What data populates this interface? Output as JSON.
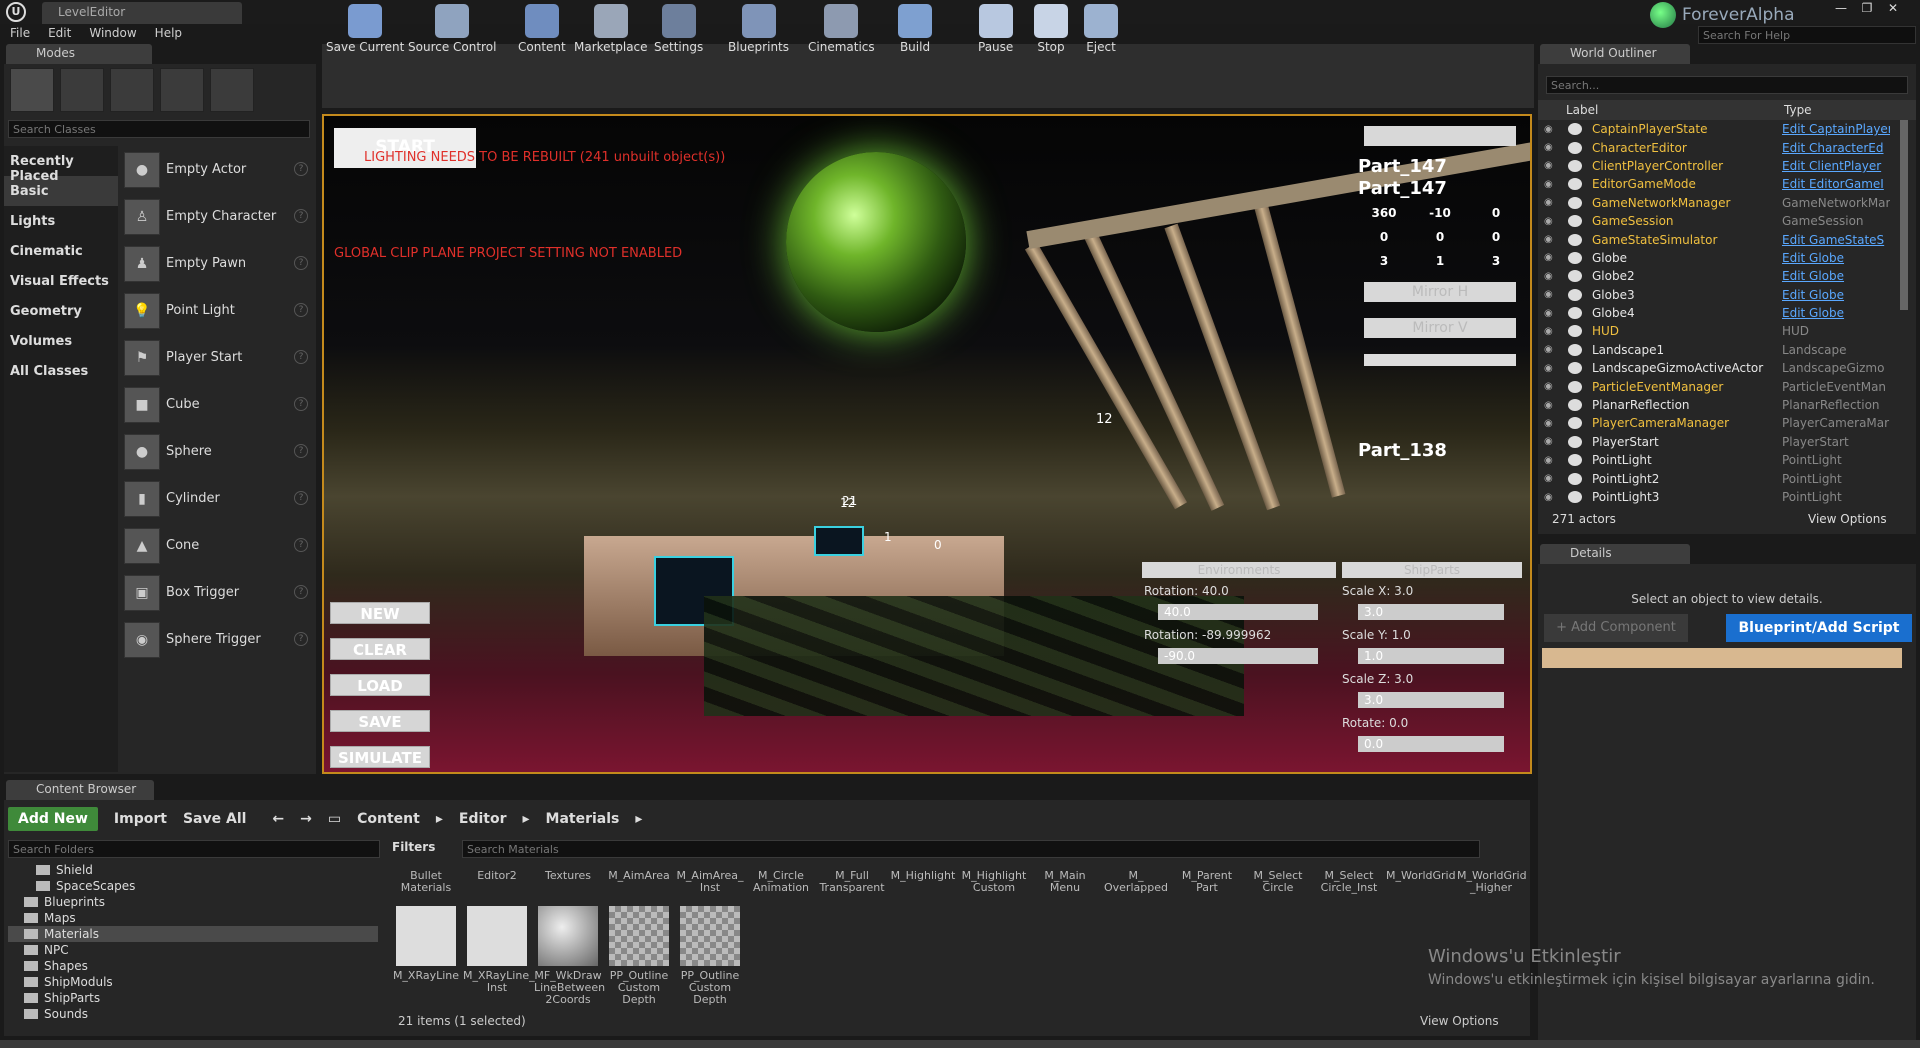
{
  "window": {
    "doc_tab": "LevelEditor",
    "brand": "ForeverAlpha",
    "search_help": "Search For Help",
    "min": "—",
    "max": "❐",
    "close": "✕"
  },
  "menu": [
    "File",
    "Edit",
    "Window",
    "Help"
  ],
  "modes": {
    "tab": "Modes",
    "search_placeholder": "Search Classes",
    "categories": [
      "Recently Placed",
      "Basic",
      "Lights",
      "Cinematic",
      "Visual Effects",
      "Geometry",
      "Volumes",
      "All Classes"
    ],
    "selected_category": "Basic",
    "actors": [
      "Empty Actor",
      "Empty Character",
      "Empty Pawn",
      "Point Light",
      "Player Start",
      "Cube",
      "Sphere",
      "Cylinder",
      "Cone",
      "Box Trigger",
      "Sphere Trigger"
    ]
  },
  "toolbar": [
    "Save Current",
    "Source Control",
    "Content",
    "Marketplace",
    "Settings",
    "Blueprints",
    "Cinematics",
    "Build",
    "Pause",
    "Stop",
    "Eject"
  ],
  "viewport": {
    "start": "START",
    "lighting_warning": "LIGHTING NEEDS TO BE REBUILT (241 unbuilt object(s))",
    "clip_warning": "GLOBAL CLIP PLANE PROJECT SETTING NOT ENABLED",
    "buttons": [
      "NEW",
      "CLEAR",
      "LOAD",
      "SAVE",
      "SIMULATE"
    ],
    "part_a": "Part_147",
    "part_b": "Part_147",
    "part_c": "Part_138",
    "rows": [
      [
        "360",
        "-10",
        "0"
      ],
      [
        "0",
        "0",
        "0"
      ],
      [
        "3",
        "1",
        "3"
      ]
    ],
    "mirror_h": "Mirror H",
    "mirror_v": "Mirror V",
    "environments": "Environments",
    "shipparts": "ShipParts",
    "rot1_label": "Rotation: 40.0",
    "rot1_val": "40.0",
    "rot2_label": "Rotation: -89.999962",
    "rot2_val": "-90.0",
    "sx_label": "Scale X: 3.0",
    "sx_val": "3.0",
    "sy_label": "Scale Y: 1.0",
    "sy_val": "1.0",
    "sz_label": "Scale Z: 3.0",
    "sz_val": "3.0",
    "rotate_label": "Rotate: 0.0",
    "rotate_val": "0.0",
    "nums": [
      "12",
      "21",
      "1",
      "0"
    ]
  },
  "outliner": {
    "tab": "World Outliner",
    "search_placeholder": "Search...",
    "col_label": "Label",
    "col_type": "Type",
    "rows": [
      {
        "name": "CaptainPlayerState",
        "type": "Edit CaptainPlayer",
        "link": true,
        "hl": true
      },
      {
        "name": "CharacterEditor",
        "type": "Edit CharacterEd",
        "link": true,
        "hl": true
      },
      {
        "name": "ClientPlayerController",
        "type": "Edit ClientPlayer",
        "link": true,
        "hl": true
      },
      {
        "name": "EditorGameMode",
        "type": "Edit EditorGameI",
        "link": true,
        "hl": true
      },
      {
        "name": "GameNetworkManager",
        "type": "GameNetworkMar",
        "link": false,
        "hl": true
      },
      {
        "name": "GameSession",
        "type": "GameSession",
        "link": false,
        "hl": true
      },
      {
        "name": "GameStateSimulator",
        "type": "Edit GameStateS",
        "link": true,
        "hl": true
      },
      {
        "name": "Globe",
        "type": "Edit Globe",
        "link": true,
        "hl": false
      },
      {
        "name": "Globe2",
        "type": "Edit Globe",
        "link": true,
        "hl": false
      },
      {
        "name": "Globe3",
        "type": "Edit Globe",
        "link": true,
        "hl": false
      },
      {
        "name": "Globe4",
        "type": "Edit Globe",
        "link": true,
        "hl": false
      },
      {
        "name": "HUD",
        "type": "HUD",
        "link": false,
        "hl": true
      },
      {
        "name": "Landscape1",
        "type": "Landscape",
        "link": false,
        "hl": false
      },
      {
        "name": "LandscapeGizmoActiveActor",
        "type": "LandscapeGizmo",
        "link": false,
        "hl": false
      },
      {
        "name": "ParticleEventManager",
        "type": "ParticleEventMan",
        "link": false,
        "hl": true
      },
      {
        "name": "PlanarReflection",
        "type": "PlanarReflection",
        "link": false,
        "hl": false
      },
      {
        "name": "PlayerCameraManager",
        "type": "PlayerCameraMar",
        "link": false,
        "hl": true
      },
      {
        "name": "PlayerStart",
        "type": "PlayerStart",
        "link": false,
        "hl": false
      },
      {
        "name": "PointLight",
        "type": "PointLight",
        "link": false,
        "hl": false
      },
      {
        "name": "PointLight2",
        "type": "PointLight",
        "link": false,
        "hl": false
      },
      {
        "name": "PointLight3",
        "type": "PointLight",
        "link": false,
        "hl": false
      }
    ],
    "count": "271 actors",
    "view_options": "View Options"
  },
  "details": {
    "tab": "Details",
    "message": "Select an object to view details.",
    "add_component": "+ Add Component",
    "blueprint": "Blueprint/Add Script"
  },
  "content_browser": {
    "tab": "Content Browser",
    "add_new": "Add New",
    "import": "Import",
    "save_all": "Save All",
    "path": [
      "Content",
      "Editor",
      "Materials"
    ],
    "folder_search": "Search Folders",
    "filters": "Filters",
    "mat_search": "Search Materials",
    "folders": [
      {
        "name": "Shield",
        "sel": false
      },
      {
        "name": "SpaceScapes",
        "sel": false
      },
      {
        "name": "Blueprints",
        "sel": false
      },
      {
        "name": "Maps",
        "sel": false
      },
      {
        "name": "Materials",
        "sel": true
      },
      {
        "name": "NPC",
        "sel": false
      },
      {
        "name": "Shapes",
        "sel": false
      },
      {
        "name": "ShipModuls",
        "sel": false
      },
      {
        "name": "ShipParts",
        "sel": false
      },
      {
        "name": "Sounds",
        "sel": false
      }
    ],
    "top_assets": [
      "Bullet Materials",
      "Editor2",
      "Textures",
      "M_AimArea",
      "M_AimArea_ Inst",
      "M_Circle Animation",
      "M_Full Transparent",
      "M_Highlight",
      "M_Highlight Custom",
      "M_Main Menu",
      "M_ Overlapped",
      "M_Parent Part",
      "M_Select Circle",
      "M_Select Circle_Inst",
      "M_WorldGrid",
      "M_WorldGrid _Higher"
    ],
    "bottom_assets": [
      "M_XRayLine",
      "M_XRayLine_ Inst",
      "MF_WkDraw LineBetween 2Coords",
      "PP_Outline Custom Depth",
      "PP_Outline Custom Depth"
    ],
    "count": "21 items (1 selected)",
    "view_options": "View Options"
  },
  "watermark": {
    "line1": "Windows'u Etkinleştir",
    "line2": "Windows'u etkinleştirmek için kişisel bilgisayar ayarlarına gidin."
  }
}
